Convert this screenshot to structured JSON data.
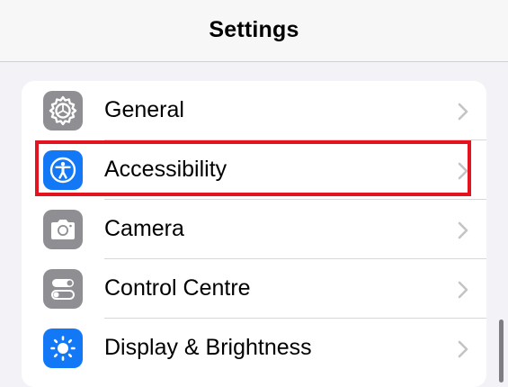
{
  "nav": {
    "title": "Settings"
  },
  "rows": [
    {
      "label": "General",
      "icon": "gear-icon",
      "icon_bg": "#8e8e93"
    },
    {
      "label": "Accessibility",
      "icon": "accessibility-icon",
      "icon_bg": "#1378f6"
    },
    {
      "label": "Camera",
      "icon": "camera-icon",
      "icon_bg": "#8e8e93"
    },
    {
      "label": "Control Centre",
      "icon": "toggles-icon",
      "icon_bg": "#8e8e93"
    },
    {
      "label": "Display & Brightness",
      "icon": "sun-icon",
      "icon_bg": "#1378f6"
    }
  ],
  "colors": {
    "highlight": "#e3131f",
    "chevron": "#c4c4c7",
    "background": "#f2f2f7"
  },
  "highlighted_row": "Accessibility"
}
